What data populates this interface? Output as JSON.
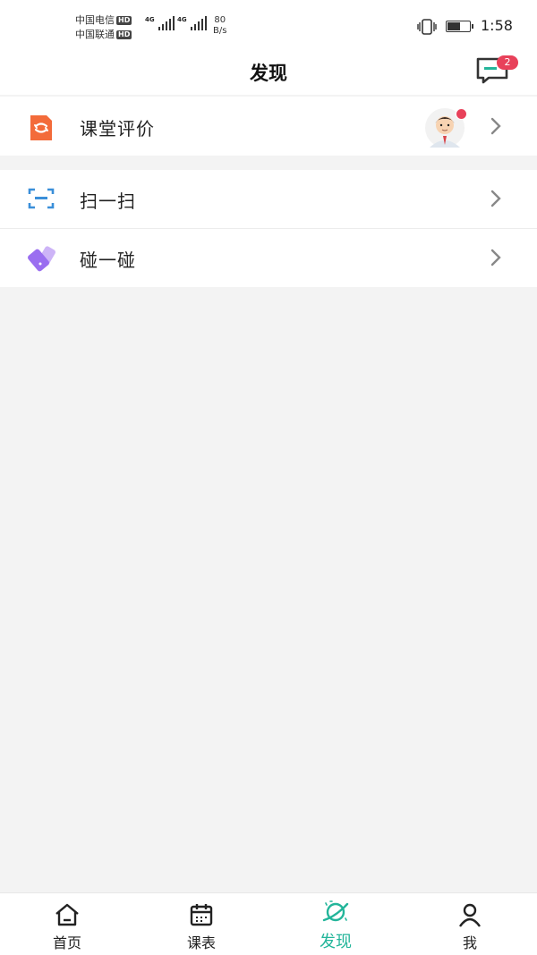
{
  "status_bar": {
    "carrier1": "中国电信",
    "carrier2": "中国联通",
    "hd": "HD",
    "net1": "4G",
    "net2": "4G",
    "speed_value": "80",
    "speed_unit": "B/s",
    "battery_level": 0.6,
    "time": "1:58"
  },
  "header": {
    "title": "发现",
    "message_badge": "2"
  },
  "items": [
    {
      "label": "课堂评价",
      "icon": "classroom-evaluation-icon"
    },
    {
      "label": "扫一扫",
      "icon": "scan-icon"
    },
    {
      "label": "碰一碰",
      "icon": "bump-phone-icon"
    }
  ],
  "tabs": [
    {
      "label": "首页",
      "icon": "home-icon"
    },
    {
      "label": "课表",
      "icon": "calendar-icon"
    },
    {
      "label": "发现",
      "icon": "planet-icon",
      "active": true
    },
    {
      "label": "我",
      "icon": "user-icon"
    }
  ],
  "colors": {
    "accent": "#23b59a",
    "badge": "#e8415a",
    "orange": "#f36b3a",
    "blue": "#3a8fd9",
    "purple": "#9a6ef0"
  }
}
